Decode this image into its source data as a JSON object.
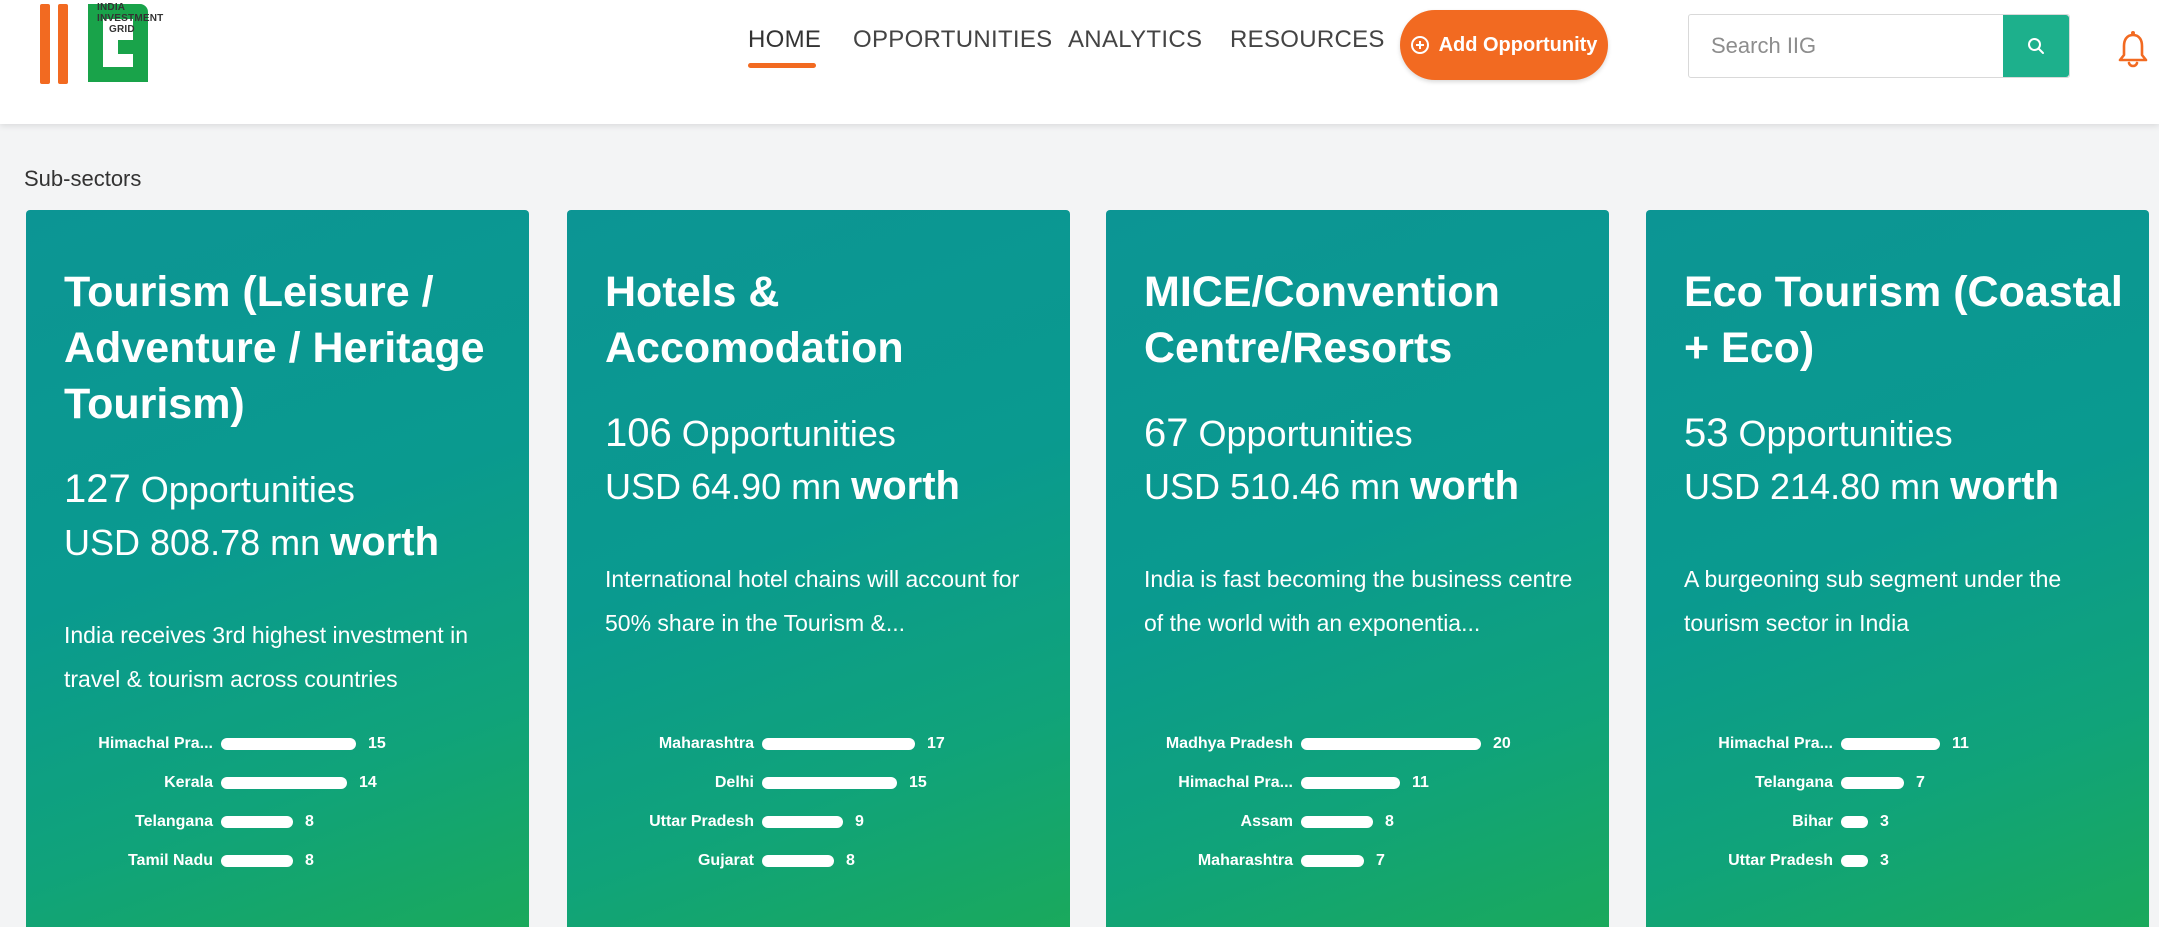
{
  "header": {
    "logo": {
      "text_line1": "INDIA",
      "text_line2": "INVESTMENT",
      "text_line3": "GRID"
    },
    "nav": [
      {
        "label": "HOME",
        "active": true
      },
      {
        "label": "OPPORTUNITIES",
        "active": false
      },
      {
        "label": "ANALYTICS",
        "active": false
      },
      {
        "label": "RESOURCES",
        "active": false
      }
    ],
    "add_button_label": "Add Opportunity",
    "search_placeholder": "Search IIG",
    "colors": {
      "accent": "#f26a21",
      "search_button": "#1db08c",
      "logo_green": "#19a34a"
    }
  },
  "section_title": "Sub-sectors",
  "cards": [
    {
      "title": "Tourism (Leisure / Adventure / Heritage Tourism)",
      "count": "127",
      "count_suffix": "Opportunities",
      "amount": "USD 808.78 mn",
      "worth_label": "worth",
      "description": "India receives 3rd highest investment in travel & tourism across countries",
      "states": [
        {
          "name": "Himachal Pra...",
          "count": 15
        },
        {
          "name": "Kerala",
          "count": 14
        },
        {
          "name": "Telangana",
          "count": 8
        },
        {
          "name": "Tamil Nadu",
          "count": 8
        }
      ]
    },
    {
      "title": "Hotels & Accomodation",
      "count": "106",
      "count_suffix": "Opportunities",
      "amount": "USD 64.90 mn",
      "worth_label": "worth",
      "description": "International hotel chains will account for 50% share in the Tourism &...",
      "states": [
        {
          "name": "Maharashtra",
          "count": 17
        },
        {
          "name": "Delhi",
          "count": 15
        },
        {
          "name": "Uttar Pradesh",
          "count": 9
        },
        {
          "name": "Gujarat",
          "count": 8
        }
      ]
    },
    {
      "title": "MICE/Convention Centre/Resorts",
      "count": "67",
      "count_suffix": "Opportunities",
      "amount": "USD 510.46 mn",
      "worth_label": "worth",
      "description": "India is fast becoming the business centre of the world with an exponentia...",
      "states": [
        {
          "name": "Madhya Pradesh",
          "count": 20
        },
        {
          "name": "Himachal Pra...",
          "count": 11
        },
        {
          "name": "Assam",
          "count": 8
        },
        {
          "name": "Maharashtra",
          "count": 7
        }
      ]
    },
    {
      "title": "Eco Tourism (Coastal + Eco)",
      "count": "53",
      "count_suffix": "Opportunities",
      "amount": "USD 214.80 mn",
      "worth_label": "worth",
      "description": "A burgeoning sub segment under the tourism sector in India",
      "states": [
        {
          "name": "Himachal Pra...",
          "count": 11
        },
        {
          "name": "Telangana",
          "count": 7
        },
        {
          "name": "Bihar",
          "count": 3
        },
        {
          "name": "Uttar Pradesh",
          "count": 3
        }
      ]
    }
  ]
}
